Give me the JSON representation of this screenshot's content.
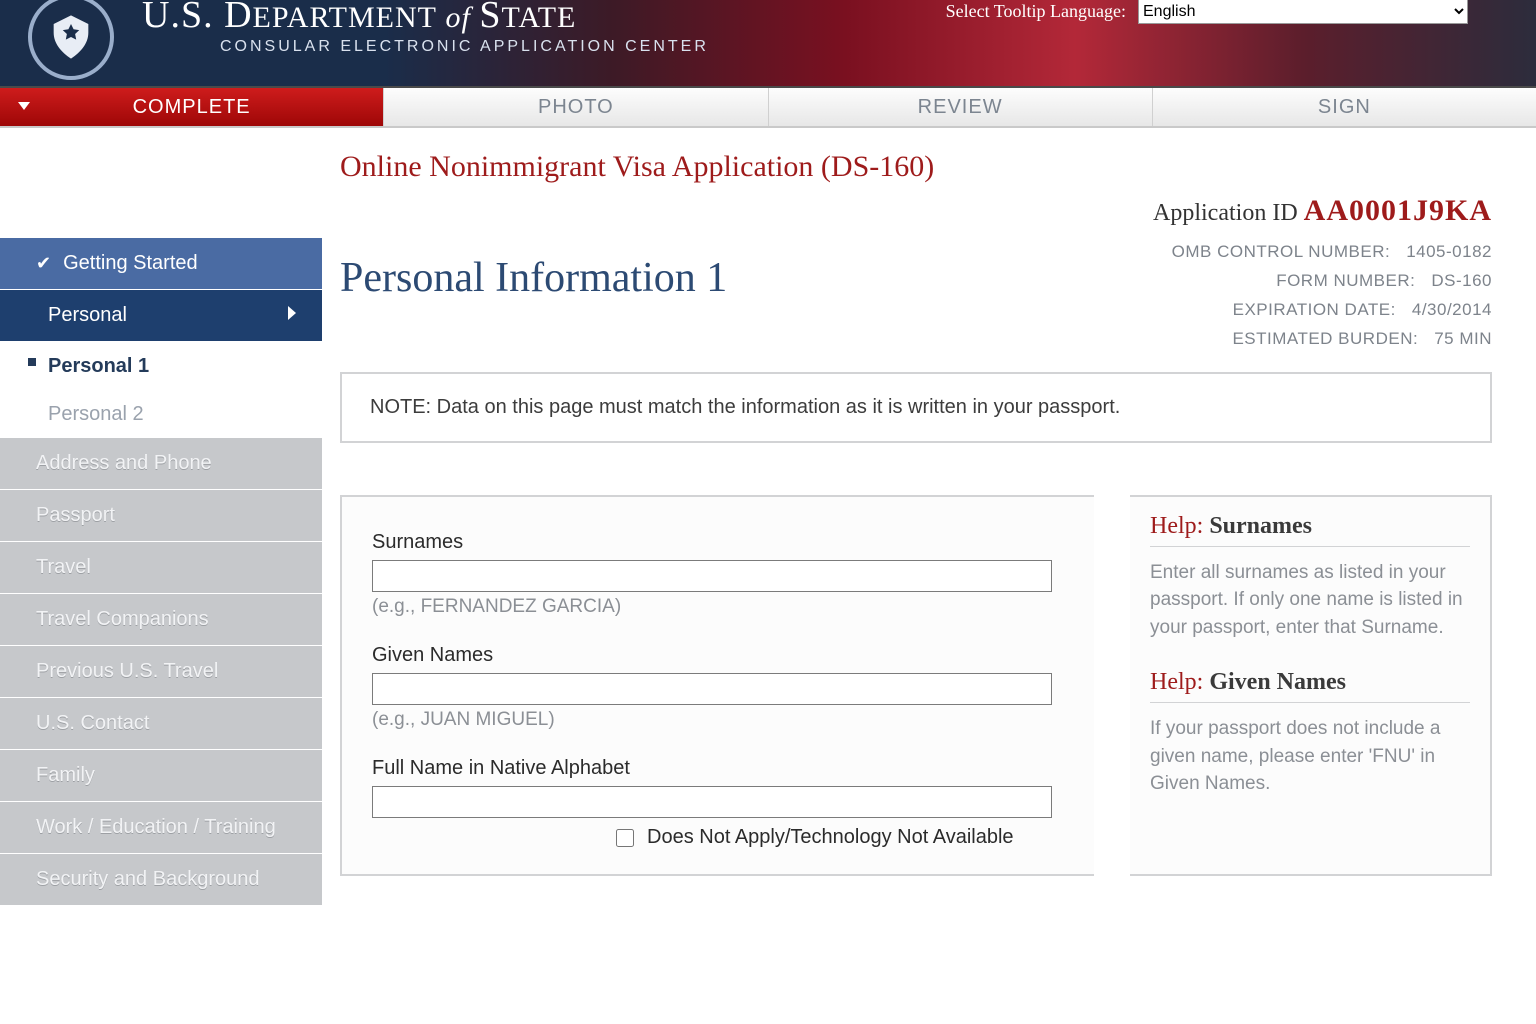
{
  "banner": {
    "dept_prefix": "U.S. D",
    "dept_mid1": "EPARTMENT",
    "dept_of": " of ",
    "dept_mid2": "S",
    "dept_suffix": "TATE",
    "subtitle": "CONSULAR ELECTRONIC APPLICATION CENTER",
    "language_label": "Select Tooltip Language:",
    "language_value": "English"
  },
  "tabs": {
    "complete": "COMPLETE",
    "photo": "PHOTO",
    "review": "REVIEW",
    "sign": "SIGN"
  },
  "sidebar": {
    "getting_started": "Getting Started",
    "personal": "Personal",
    "personal_1": "Personal 1",
    "personal_2": "Personal 2",
    "disabled": [
      "Address and Phone",
      "Passport",
      "Travel",
      "Travel Companions",
      "Previous U.S. Travel",
      "U.S. Contact",
      "Family",
      "Work / Education / Training",
      "Security and Background"
    ]
  },
  "page": {
    "title": "Online Nonimmigrant Visa Application (DS-160)",
    "app_id_label": "Application ID",
    "app_id_value": "AA0001J9KA",
    "meta": {
      "omb_label": "OMB CONTROL NUMBER:",
      "omb_value": "1405-0182",
      "form_label": "FORM NUMBER:",
      "form_value": "DS-160",
      "exp_label": "EXPIRATION DATE:",
      "exp_value": "4/30/2014",
      "burden_label": "ESTIMATED BURDEN:",
      "burden_value": "75 MIN"
    },
    "section_head": "Personal Information 1",
    "note": "NOTE: Data on this page must match the information as it is written in your passport."
  },
  "form": {
    "surnames_label": "Surnames",
    "surnames_hint": "(e.g., FERNANDEZ GARCIA)",
    "given_label": "Given Names",
    "given_hint": "(e.g., JUAN MIGUEL)",
    "native_label": "Full Name in Native Alphabet",
    "na_checkbox": "Does Not Apply/Technology Not Available"
  },
  "help": {
    "prefix": "Help: ",
    "surnames_title": "Surnames",
    "surnames_body": "Enter all surnames as listed in your passport. If only one name is listed in your passport, enter that Surname.",
    "given_title": "Given Names",
    "given_body": "If your passport does not include a given name, please enter 'FNU' in Given Names."
  }
}
